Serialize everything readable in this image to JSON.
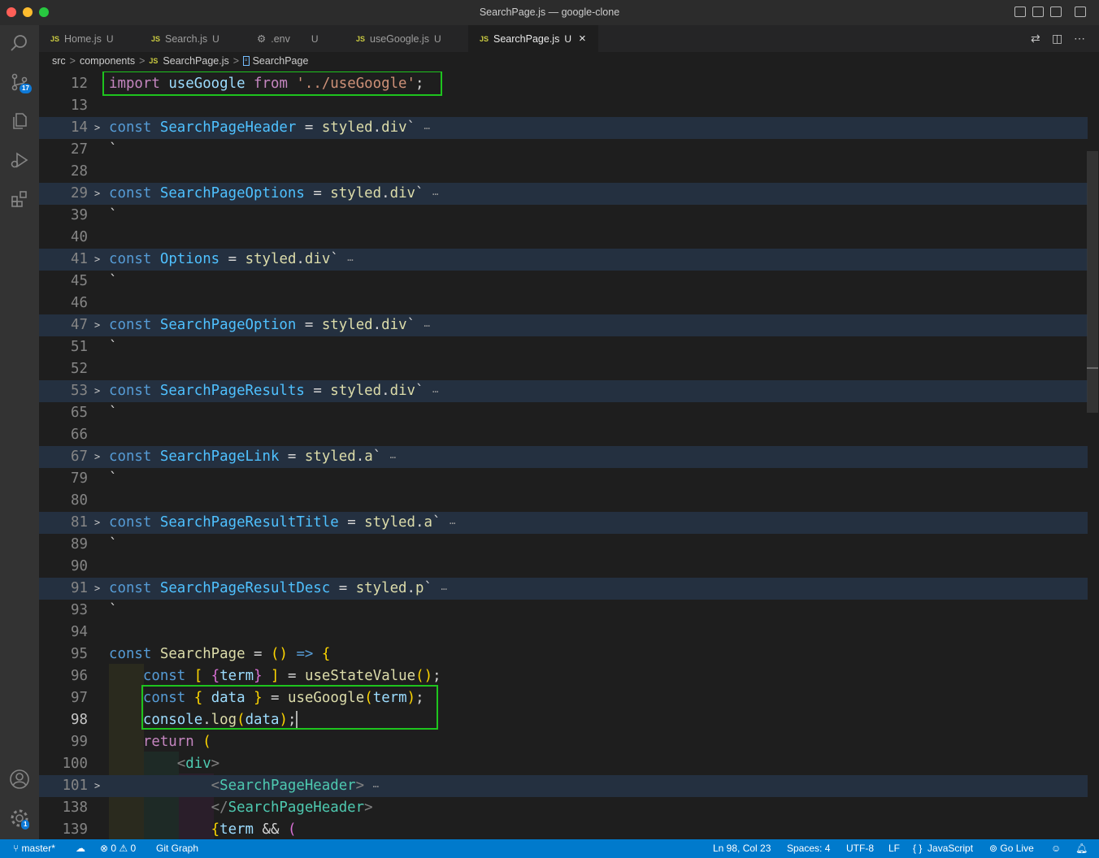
{
  "window": {
    "title": "SearchPage.js — google-clone"
  },
  "tabs": [
    {
      "icon": "JS",
      "label": "Home.js",
      "status": "U"
    },
    {
      "icon": "JS",
      "label": "Search.js",
      "status": "U"
    },
    {
      "icon": "gear",
      "label": ".env",
      "status": "U"
    },
    {
      "icon": "JS",
      "label": "useGoogle.js",
      "status": "U"
    },
    {
      "icon": "JS",
      "label": "SearchPage.js",
      "status": "U",
      "close": "×"
    }
  ],
  "breadcrumb": {
    "part1": "src",
    "part2": "components",
    "part3": "SearchPage.js",
    "part4": "SearchPage",
    "sep": ">",
    "js_icon": "JS"
  },
  "activity": {
    "scm_badge": "17",
    "settings_badge": "1"
  },
  "editor": {
    "lines": [
      {
        "n": "12",
        "code": "import useGoogle from '../useGoogle';"
      },
      {
        "n": "13",
        "code": ""
      },
      {
        "n": "14",
        "code": "const SearchPageHeader = styled.div`⋯"
      },
      {
        "n": "27",
        "code": "`"
      },
      {
        "n": "28",
        "code": ""
      },
      {
        "n": "29",
        "code": "const SearchPageOptions = styled.div`⋯"
      },
      {
        "n": "39",
        "code": "`"
      },
      {
        "n": "40",
        "code": ""
      },
      {
        "n": "41",
        "code": "const Options = styled.div`⋯"
      },
      {
        "n": "45",
        "code": "`"
      },
      {
        "n": "46",
        "code": ""
      },
      {
        "n": "47",
        "code": "const SearchPageOption = styled.div`⋯"
      },
      {
        "n": "51",
        "code": "`"
      },
      {
        "n": "52",
        "code": ""
      },
      {
        "n": "53",
        "code": "const SearchPageResults = styled.div`⋯"
      },
      {
        "n": "65",
        "code": "`"
      },
      {
        "n": "66",
        "code": ""
      },
      {
        "n": "67",
        "code": "const SearchPageLink = styled.a`⋯"
      },
      {
        "n": "79",
        "code": "`"
      },
      {
        "n": "80",
        "code": ""
      },
      {
        "n": "81",
        "code": "const SearchPageResultTitle = styled.a`⋯"
      },
      {
        "n": "89",
        "code": "`"
      },
      {
        "n": "90",
        "code": ""
      },
      {
        "n": "91",
        "code": "const SearchPageResultDesc = styled.p`⋯"
      },
      {
        "n": "93",
        "code": "`"
      },
      {
        "n": "94",
        "code": ""
      },
      {
        "n": "95",
        "code": "const SearchPage = () => {"
      },
      {
        "n": "96",
        "code": "    const [ {term} ] = useStateValue();"
      },
      {
        "n": "97",
        "code": "    const { data } = useGoogle(term);"
      },
      {
        "n": "98",
        "code": "    console.log(data);"
      },
      {
        "n": "99",
        "code": "    return ("
      },
      {
        "n": "100",
        "code": "        <div>"
      },
      {
        "n": "101",
        "code": "            <SearchPageHeader>⋯"
      },
      {
        "n": "138",
        "code": "            </SearchPageHeader>"
      },
      {
        "n": "139",
        "code": "            {term && ("
      }
    ]
  },
  "statusbar": {
    "branch": "master*",
    "errors": "0",
    "warnings": "0",
    "git_graph": "Git Graph",
    "position": "Ln 98, Col 23",
    "spaces": "Spaces: 4",
    "encoding": "UTF-8",
    "eol": "LF",
    "language": "JavaScript",
    "golive": "Go Live"
  },
  "colors": {
    "highlight_box": "#1ec41e",
    "statusbar": "#007acc",
    "folded_line": "#243040"
  }
}
